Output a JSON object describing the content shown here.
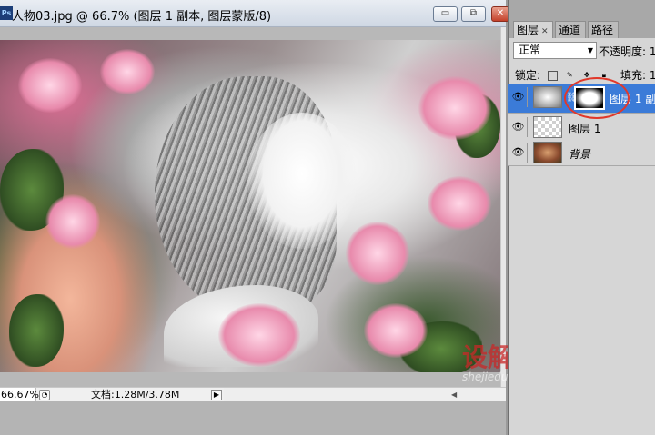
{
  "document": {
    "title": "人物03.jpg @ 66.7% (图层 1 副本, 图层蒙版/8)",
    "zoom": "66.67%",
    "doc_size": "文档:1.28M/3.78M"
  },
  "window_buttons": {
    "minimize": "▭",
    "maximize": "⧉",
    "close": "✕"
  },
  "watermark": {
    "logo": "设解读",
    "url": "shejiedu.com"
  },
  "layers_panel": {
    "tabs": [
      {
        "label": "图层",
        "active": true
      },
      {
        "label": "通道",
        "active": false
      },
      {
        "label": "路径",
        "active": false
      }
    ],
    "blend_mode": "正常",
    "opacity_label": "不透明度: 1",
    "lock_label": "锁定:",
    "fill_label": "填充: 1",
    "layers": [
      {
        "name": "图层 1 副",
        "selected": true,
        "has_mask": true
      },
      {
        "name": "图层 1",
        "selected": false,
        "has_mask": false
      },
      {
        "name": "背景",
        "selected": false,
        "has_mask": false
      }
    ]
  },
  "colors": {
    "selected_layer": "#3b7bd8",
    "annotation_ellipse": "#e1382a"
  }
}
